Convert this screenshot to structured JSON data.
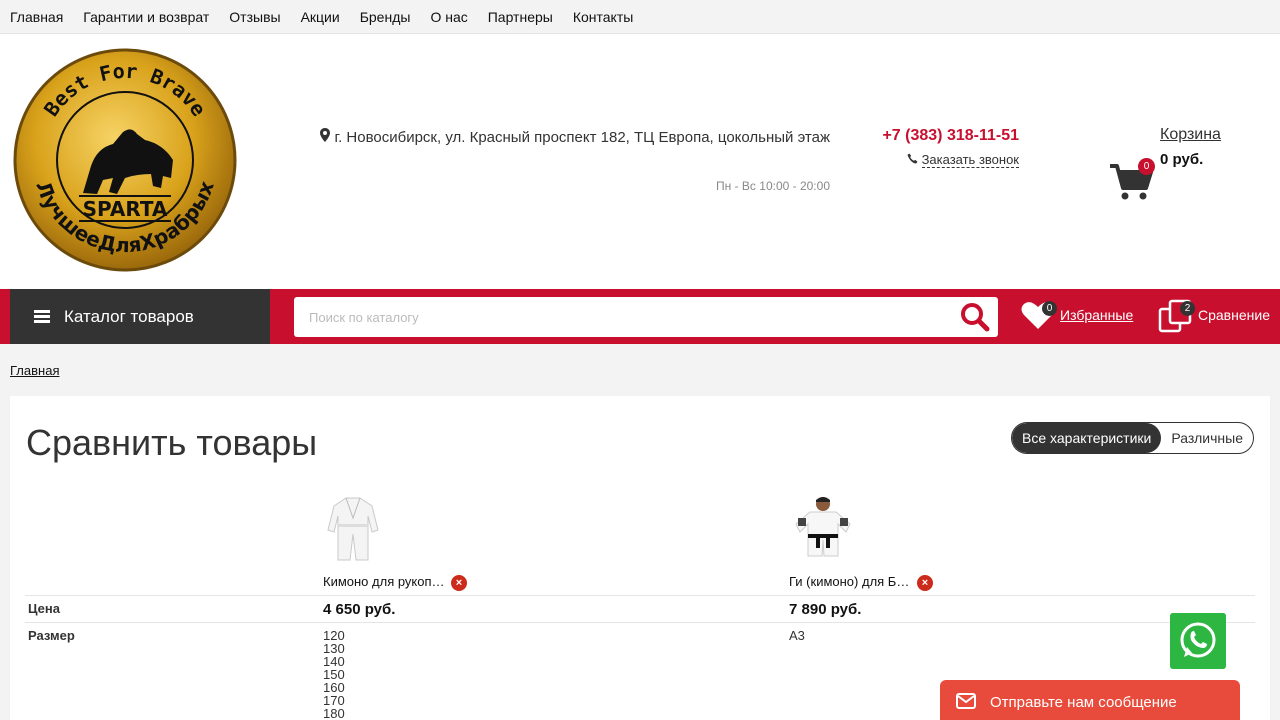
{
  "topnav": [
    "Главная",
    "Гарантии и возврат",
    "Отзывы",
    "Акции",
    "Бренды",
    "О нас",
    "Партнеры",
    "Контакты"
  ],
  "logo": {
    "top_text": "Best For Brave",
    "bottom_text": "ЛучшееДляХрабрых",
    "brand": "SPARTA"
  },
  "contact": {
    "address": "г. Новосибирск, ул. Красный проспект 182, ТЦ Европа, цокольный этаж",
    "hours": "Пн - Вс 10:00 - 20:00",
    "phone": "+7 (383) 318-11-51",
    "callback": "Заказать звонок"
  },
  "cart": {
    "count": "0",
    "title": "Корзина",
    "sum": "0 руб."
  },
  "toolbar": {
    "catalog_label": "Каталог товаров",
    "search_placeholder": "Поиск по каталогу",
    "favorites_count": "0",
    "favorites_label": "Избранные",
    "compare_count": "2",
    "compare_label": "Сравнение"
  },
  "breadcrumb": "Главная",
  "compare": {
    "title": "Сравнить товары",
    "toggle": {
      "all": "Все характеристики",
      "diff": "Различные"
    },
    "products": [
      {
        "name": "Кимоно для рукопашного боя",
        "price": "4 650 руб.",
        "sizes": [
          "120",
          "130",
          "140",
          "150",
          "160",
          "170",
          "180"
        ]
      },
      {
        "name": "Ги (кимоно) для БЖЖ",
        "price": "7 890 руб.",
        "sizes": [
          "A3"
        ]
      }
    ],
    "row_labels": {
      "price": "Цена",
      "size": "Размер"
    }
  },
  "chat": {
    "label": "Отправьте нам сообщение"
  },
  "colors": {
    "accent": "#c8102e",
    "dark": "#333333",
    "whatsapp": "#2db742",
    "chat": "#e84b3c"
  }
}
